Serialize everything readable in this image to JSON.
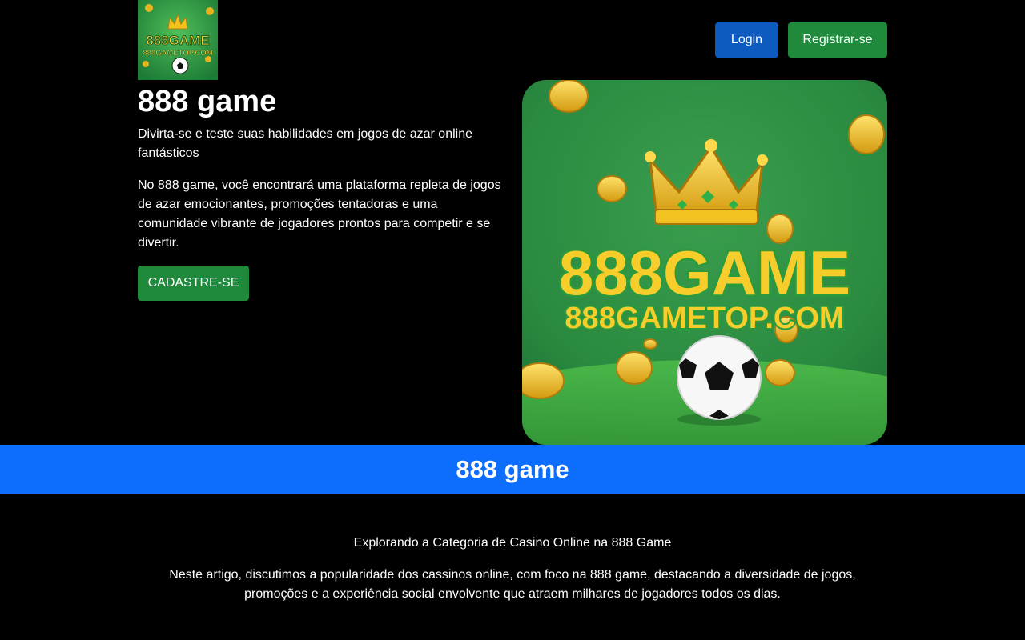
{
  "header": {
    "logo_text_top": "888GAME",
    "logo_text_bottom": "888GAMETOP.COM",
    "login_label": "Login",
    "register_label": "Registrar-se",
    "colors": {
      "login": "#0d5bbf",
      "register": "#1f8a3b"
    }
  },
  "hero": {
    "title": "888 game",
    "subtitle": "Divirta-se e teste suas habilidades em jogos de azar online fantásticos",
    "description": "No 888 game, você encontrará uma plataforma repleta de jogos de azar emocionantes, promoções tentadoras e uma comunidade vibrante de jogadores prontos para competir e se divertir.",
    "cta_label": "CADASTRE-SE",
    "image": {
      "brand_text": "888GAME",
      "domain_text": "888GAMETOP.COM",
      "icons": [
        "crown-icon",
        "soccer-ball-icon",
        "gold-coin-icon"
      ]
    }
  },
  "banner": {
    "title": "888 game",
    "color": "#0d6efd"
  },
  "article": {
    "title": "Explorando a Categoria de Casino Online na 888 Game",
    "body": "Neste artigo, discutimos a popularidade dos cassinos online, com foco na 888 game, destacando a diversidade de jogos, promoções e a experiência social envolvente que atraem milhares de jogadores todos os dias."
  }
}
